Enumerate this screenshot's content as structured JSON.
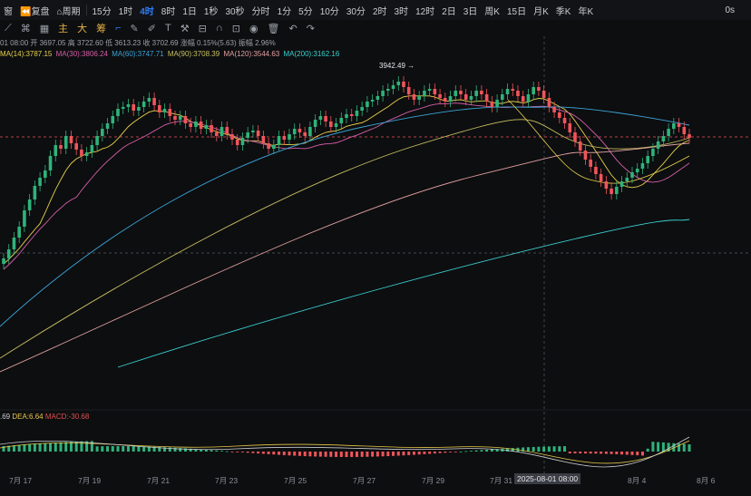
{
  "topbar": {
    "items": [
      "窗",
      "复盘",
      "周期",
      "15分",
      "1时",
      "4时",
      "8时",
      "1日",
      "1秒",
      "30秒",
      "分时",
      "1分",
      "5分",
      "10分",
      "30分",
      "2时",
      "3时",
      "12时",
      "2日",
      "3日",
      "周K",
      "15日",
      "月K",
      "季K",
      "年K"
    ],
    "active": "4时",
    "right": "0s"
  },
  "toolbar": {
    "labels": [
      "主",
      "大",
      "筹"
    ]
  },
  "info": {
    "line1": [
      {
        "text": "01 08:00 开 3697.05 高 3722.60 低 3613.23 收 3702.69 涨幅 0.15%(5.63) 振幅 2.96%"
      }
    ],
    "ma": [
      {
        "text": "MA(14):3787.15",
        "color": "#e8d24a"
      },
      {
        "text": "MA(30):3806.24",
        "color": "#d45fa8"
      },
      {
        "text": "MA(60):3747.71",
        "color": "#3aa3d6"
      },
      {
        "text": "MA(90):3708.39",
        "color": "#c8c060"
      },
      {
        "text": "MA(120):3544.63",
        "color": "#e0a0a0"
      },
      {
        "text": "MA(200):3162.16",
        "color": "#3ad0d0"
      }
    ],
    "macd": [
      {
        "text": ".69",
        "color": "#c9ccd1"
      },
      {
        "text": "DEA:6.64",
        "color": "#e8c84a"
      },
      {
        "text": "MACD:-30.68",
        "color": "#e05050"
      }
    ]
  },
  "annotation": {
    "high_label": "3942.49"
  },
  "xaxis": {
    "ticks": [
      "7月 17",
      "7月 19",
      "7月 21",
      "7月 23",
      "7月 25",
      "7月 27",
      "7月 29",
      "7月 31",
      "8月 4",
      "8月 6"
    ],
    "highlight": "2025-08-01 08:00"
  },
  "colors": {
    "up": "#2fb37a",
    "down": "#f0555a",
    "bg": "#0d0e10",
    "accent": "#2f7cf6"
  },
  "chart_data": {
    "type": "candlestick",
    "title": "",
    "interval": "4时",
    "y_reference": {
      "high_marked": 3942.49
    },
    "last_bar": {
      "time": "2025-08-01 08:00",
      "open": 3697.05,
      "high": 3722.6,
      "low": 3613.23,
      "close": 3702.69,
      "change_pct": 0.15,
      "change": 5.63,
      "amplitude_pct": 2.96
    },
    "moving_averages": [
      {
        "name": "MA(14)",
        "value": 3787.15
      },
      {
        "name": "MA(30)",
        "value": 3806.24
      },
      {
        "name": "MA(60)",
        "value": 3747.71
      },
      {
        "name": "MA(90)",
        "value": 3708.39
      },
      {
        "name": "MA(120)",
        "value": 3544.63
      },
      {
        "name": "MA(200)",
        "value": 3162.16
      }
    ],
    "macd": {
      "dea": 6.64,
      "macd": -30.68
    }
  }
}
